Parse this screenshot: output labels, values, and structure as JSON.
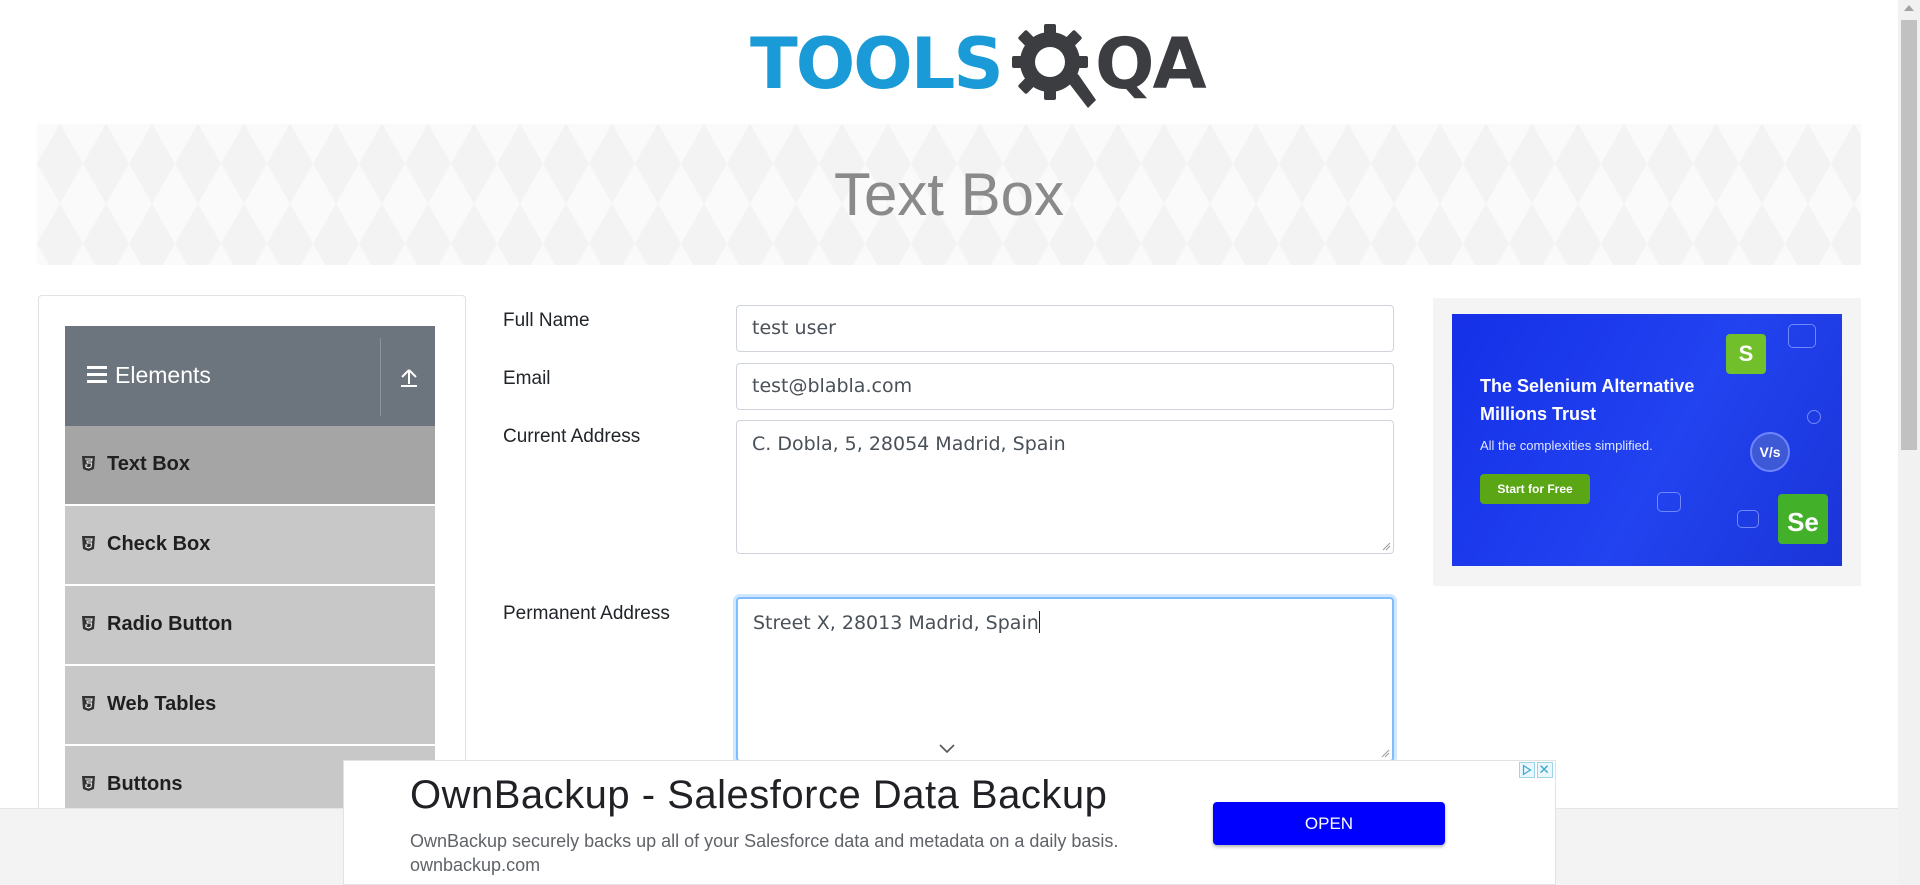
{
  "header": {
    "logo_text_tools": "TOOLS",
    "logo_text_qa": "QA",
    "banner_title": "Text Box"
  },
  "sidebar": {
    "group_title": "Elements",
    "items": [
      {
        "label": "Text Box",
        "active": true
      },
      {
        "label": "Check Box"
      },
      {
        "label": "Radio Button"
      },
      {
        "label": "Web Tables"
      },
      {
        "label": "Buttons"
      }
    ]
  },
  "form": {
    "full_name": {
      "label": "Full Name",
      "value": "test user"
    },
    "email": {
      "label": "Email",
      "value": "test@blabla.com"
    },
    "current_address": {
      "label": "Current Address",
      "value": "C. Dobla, 5, 28054 Madrid, Spain"
    },
    "permanent_address": {
      "label": "Permanent Address",
      "value": "Street X, 28013 Madrid, Spain"
    }
  },
  "right_ad": {
    "headline": "The Selenium Alternative Millions Trust",
    "subtext": "All the complexities simplified.",
    "button": "Start for Free",
    "s_badge": "S",
    "vs_badge": "V/s",
    "se_badge": "Se"
  },
  "bottom_ad": {
    "title": "OwnBackup - Salesforce Data Backup",
    "description": "OwnBackup securely backs up all of your Salesforce data and metadata on a daily basis. ownbackup.com",
    "button": "OPEN"
  },
  "colors": {
    "accent_blue": "#1a9bd7",
    "sidebar_header": "#6c757d",
    "open_button": "#0000ff"
  }
}
